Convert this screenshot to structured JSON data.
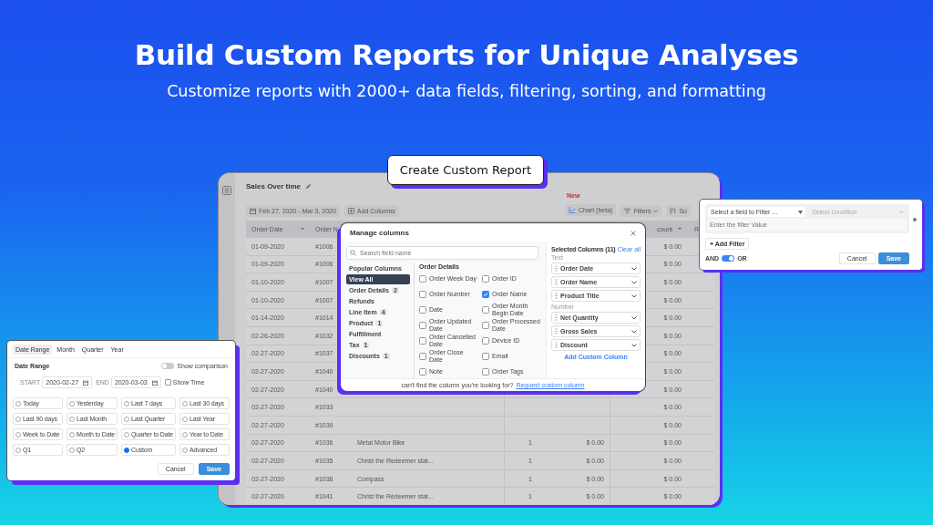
{
  "headline": "Build Custom Reports for Unique Analyses",
  "subheadline": "Customize reports with 2000+ data fields, filtering, sorting, and formatting",
  "cta_button": "Create Custom Report",
  "report": {
    "title": "Sales Over time",
    "date_range": "Feb 27, 2020 - Mar 3, 2020",
    "add_columns": "Add Columns",
    "new_badge": "New",
    "chart_button": "Chart (beta)",
    "filters_button": "Filters",
    "sort_button": "So",
    "columns": [
      "Order Date",
      "Order N",
      "",
      "",
      "",
      "count",
      "R"
    ],
    "rows": [
      {
        "cells": [
          "01-09-2020",
          "#1006",
          "",
          "",
          "",
          "$ 0.00",
          ""
        ]
      },
      {
        "cells": [
          "01-09-2020",
          "#1006",
          "",
          "",
          "",
          "$ 0.00",
          ""
        ]
      },
      {
        "cells": [
          "01-10-2020",
          "#1007",
          "",
          "",
          "",
          "$ 0.00",
          ""
        ]
      },
      {
        "cells": [
          "01-10-2020",
          "#1007",
          "",
          "",
          "",
          "$ 0.00",
          ""
        ]
      },
      {
        "cells": [
          "01-14-2020",
          "#1014",
          "",
          "",
          "",
          "$ 0.00",
          ""
        ]
      },
      {
        "cells": [
          "02-26-2020",
          "#1032",
          "",
          "",
          "",
          "$ 0.00",
          ""
        ]
      },
      {
        "cells": [
          "02-27-2020",
          "#1037",
          "",
          "",
          "",
          "$ 0.00",
          ""
        ]
      },
      {
        "cells": [
          "02-27-2020",
          "#1040",
          "",
          "",
          "",
          "$ 0.00",
          ""
        ]
      },
      {
        "cells": [
          "02-27-2020",
          "#1040",
          "",
          "",
          "",
          "$ 0.00",
          ""
        ]
      },
      {
        "cells": [
          "02-27-2020",
          "#1033",
          "",
          "",
          "",
          "$ 0.00",
          ""
        ]
      },
      {
        "cells": [
          "02-27-2020",
          "#1039",
          "",
          "",
          "",
          "$ 0.00",
          ""
        ]
      },
      {
        "cells": [
          "02-27-2020",
          "#1036",
          "Metal Motor Bike",
          "1",
          "$ 0.00",
          "$ 0.00",
          ""
        ]
      },
      {
        "cells": [
          "02-27-2020",
          "#1035",
          "Christ the Redeemer stat...",
          "1",
          "$ 0.00",
          "$ 0.00",
          ""
        ]
      },
      {
        "cells": [
          "02-27-2020",
          "#1038",
          "Compass",
          "1",
          "$ 0.00",
          "$ 0.00",
          ""
        ]
      },
      {
        "cells": [
          "02-27-2020",
          "#1041",
          "Christ the Redeemer stat...",
          "1",
          "$ 0.00",
          "$ 0.00",
          ""
        ]
      }
    ]
  },
  "manage_columns": {
    "title": "Manage columns",
    "search_placeholder": "Search field name",
    "nav": [
      {
        "label": "Popular Columns",
        "selected": false
      },
      {
        "label": "View All",
        "selected": true
      },
      {
        "label": "Order Details",
        "count": "2",
        "selected": false
      },
      {
        "label": "Refunds",
        "selected": false
      },
      {
        "label": "Line Item",
        "count": "4",
        "selected": false
      },
      {
        "label": "Product",
        "count": "1",
        "selected": false
      },
      {
        "label": "Fulfillment",
        "selected": false
      },
      {
        "label": "Tax",
        "count": "1",
        "selected": false
      },
      {
        "label": "Discounts",
        "count": "1",
        "selected": false
      }
    ],
    "section_title": "Order Details",
    "fields": [
      {
        "label": "Order Week Day",
        "checked": false
      },
      {
        "label": "Order ID",
        "checked": false
      },
      {
        "label": "Order Number",
        "checked": false
      },
      {
        "label": "Order Name",
        "checked": true
      },
      {
        "label": "Date",
        "checked": false
      },
      {
        "label": "Order Month Begin Date",
        "checked": false
      },
      {
        "label": "Order Updated Date",
        "checked": false
      },
      {
        "label": "Order Processed Date",
        "checked": false
      },
      {
        "label": "Order Cancelled Date",
        "checked": false
      },
      {
        "label": "Device ID",
        "checked": false
      },
      {
        "label": "Order Close Date",
        "checked": false
      },
      {
        "label": "Email",
        "checked": false
      },
      {
        "label": "Note",
        "checked": false
      },
      {
        "label": "Order Tags",
        "checked": false
      }
    ],
    "selected_title": "Selected Columns (11)",
    "clear_all": "Clear all",
    "groups": [
      {
        "label": "Text",
        "items": [
          "Order Date",
          "Order Name",
          "Product Title"
        ]
      },
      {
        "label": "Number",
        "items": [
          "Net Quantity",
          "Gross Sales",
          "Discount"
        ]
      }
    ],
    "add_custom": "Add Custom Column",
    "footer_text": "can't find the column you're looking for?",
    "footer_link": "Request custom column"
  },
  "filter_popup": {
    "field_select": "Select a field to Filter ...",
    "condition_select": "Select condition",
    "value_placeholder": "Enter the filter Value",
    "add_filter": "+ Add Filter",
    "and_label": "AND",
    "or_label": "OR",
    "toggle_on": true,
    "cancel": "Cancel",
    "save": "Save"
  },
  "date_popup": {
    "tabs": [
      {
        "label": "Date Range",
        "selected": true
      },
      {
        "label": "Month",
        "selected": false
      },
      {
        "label": "Quarter",
        "selected": false
      },
      {
        "label": "Year",
        "selected": false
      }
    ],
    "heading": "Date Range",
    "comparison_label": "Show comparison",
    "comparison_on": false,
    "start_label": "START",
    "start_value": "2020-02-27",
    "end_label": "END",
    "end_value": "2020-03-03",
    "show_time_label": "Show Time",
    "show_time_checked": false,
    "options": [
      {
        "label": "Today",
        "selected": false
      },
      {
        "label": "Yesterday",
        "selected": false
      },
      {
        "label": "Last 7 days",
        "selected": false
      },
      {
        "label": "Last 30 days",
        "selected": false
      },
      {
        "label": "Last 90 days",
        "selected": false
      },
      {
        "label": "Last Month",
        "selected": false
      },
      {
        "label": "Last Quarter",
        "selected": false
      },
      {
        "label": "Last Year",
        "selected": false
      },
      {
        "label": "Week to Date",
        "selected": false
      },
      {
        "label": "Month to Date",
        "selected": false
      },
      {
        "label": "Quarter to Date",
        "selected": false
      },
      {
        "label": "Year to Date",
        "selected": false
      },
      {
        "label": "Q1",
        "selected": false
      },
      {
        "label": "Q2",
        "selected": false
      },
      {
        "label": "Custom",
        "selected": true
      },
      {
        "label": "Advanced",
        "selected": false
      }
    ],
    "cancel": "Cancel",
    "save": "Save"
  }
}
